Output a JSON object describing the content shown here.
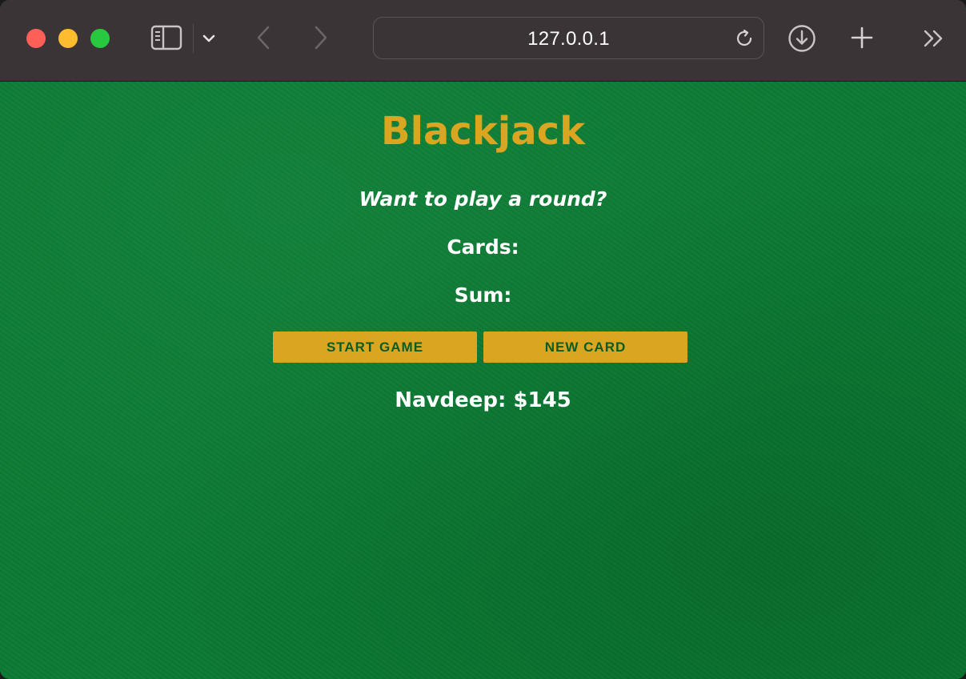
{
  "browser": {
    "address": "127.0.0.1",
    "icons": {
      "sidebar": "sidebar-icon",
      "dropdown": "chevron-down-icon",
      "back": "chevron-left-icon",
      "forward": "chevron-right-icon",
      "reload": "reload-icon",
      "download": "download-icon",
      "new_tab": "plus-icon",
      "more": "double-chevron-right-icon"
    }
  },
  "game": {
    "title": "Blackjack",
    "message": "Want to play a round?",
    "cards_label": "Cards:",
    "sum_label": "Sum:",
    "start_button": "START GAME",
    "new_card_button": "NEW CARD",
    "player": "Navdeep: $145"
  },
  "colors": {
    "felt": "#0b7a33",
    "gold": "#daa520",
    "button_text": "#0a5c25",
    "toolbar": "#3a3436"
  }
}
